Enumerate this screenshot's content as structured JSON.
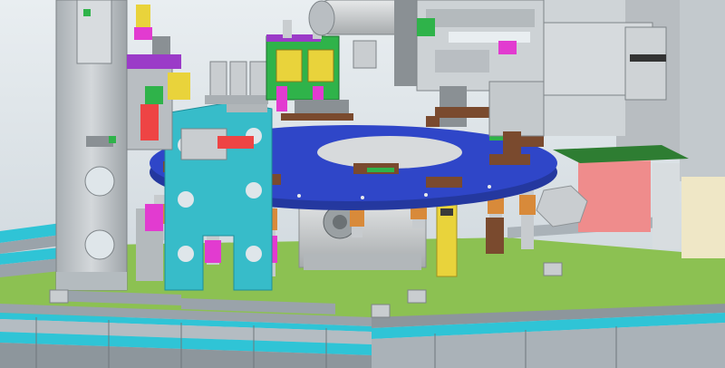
{
  "scene": {
    "description_visible_text": "",
    "colors": {
      "background_top": "#e9eef1",
      "background_bottom": "#c9d2d8",
      "base_plate": "#8cc152",
      "aluminum_profile": "#9aa3aa",
      "aluminum_cyan": "#2fc4d6",
      "turntable_blue": "#2f46c8",
      "cyan_bracket": "#37bcc9",
      "fixture_brown": "#7a4a2e",
      "pink_block": "#ef8c8c",
      "yellow_part": "#e9d33b",
      "green_part": "#2fb34a",
      "magenta_part": "#e23bd0",
      "gray_frame": "#b9bec2",
      "spring_orange": "#d88a3a",
      "motor_gray": "#cfd2d4"
    }
  }
}
